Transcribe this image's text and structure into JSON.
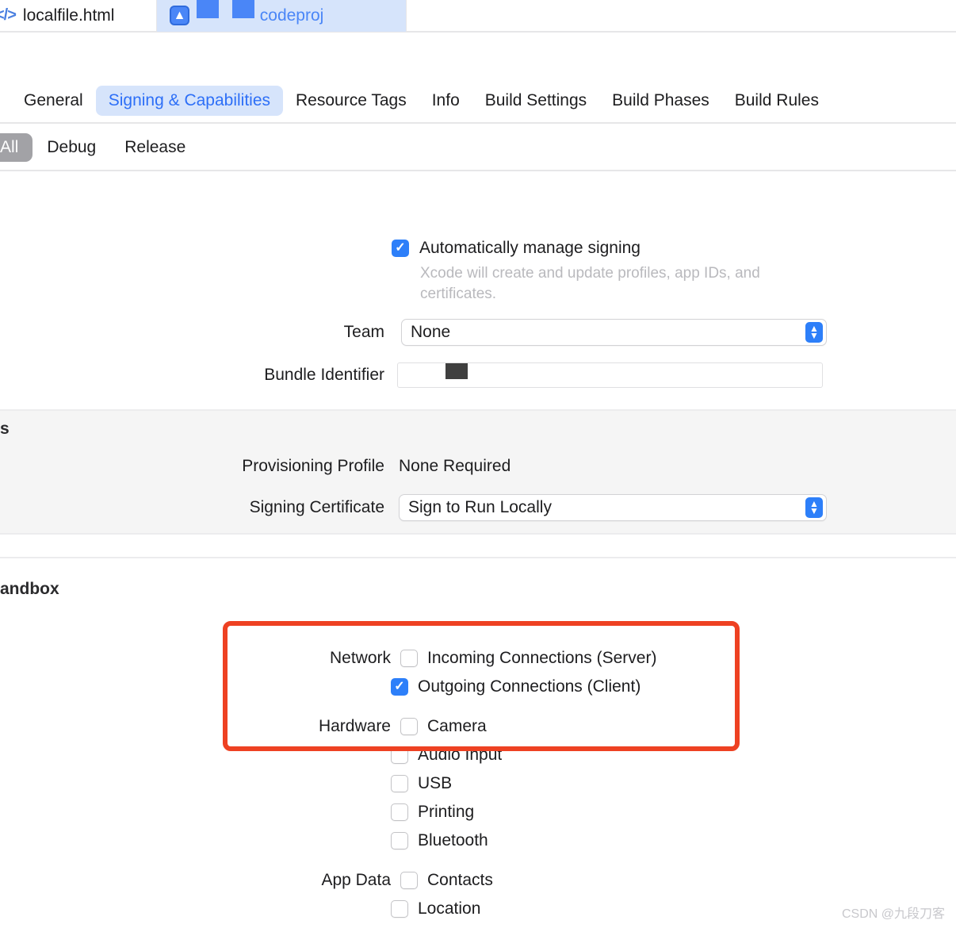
{
  "file_tabs": [
    {
      "name": "localfile.html",
      "icon": "code-file-icon",
      "active": false
    },
    {
      "name": "codeproj",
      "icon": "xcode-project-icon",
      "active": true,
      "redacted": true
    }
  ],
  "project_tabs": [
    {
      "label": "General",
      "selected": false
    },
    {
      "label": "Signing & Capabilities",
      "selected": true
    },
    {
      "label": "Resource Tags",
      "selected": false
    },
    {
      "label": "Info",
      "selected": false
    },
    {
      "label": "Build Settings",
      "selected": false
    },
    {
      "label": "Build Phases",
      "selected": false
    },
    {
      "label": "Build Rules",
      "selected": false
    }
  ],
  "configurations": [
    {
      "label": "All",
      "selected": true
    },
    {
      "label": "Debug",
      "selected": false
    },
    {
      "label": "Release",
      "selected": false
    }
  ],
  "signing": {
    "auto_manage": {
      "label": "Automatically manage signing",
      "checked": true,
      "hint": "Xcode will create and update profiles, app IDs, and certificates."
    },
    "team": {
      "label": "Team",
      "value": "None"
    },
    "bundle_identifier": {
      "label": "Bundle Identifier",
      "value": ""
    }
  },
  "macos_section": {
    "title": "s",
    "provisioning_profile": {
      "label": "Provisioning Profile",
      "value": "None Required"
    },
    "signing_certificate": {
      "label": "Signing Certificate",
      "value": "Sign to Run Locally"
    }
  },
  "app_sandbox": {
    "title": "andbox",
    "groups": [
      {
        "label": "Network",
        "items": [
          {
            "label": "Incoming Connections (Server)",
            "checked": false
          },
          {
            "label": "Outgoing Connections (Client)",
            "checked": true
          }
        ]
      },
      {
        "label": "Hardware",
        "items": [
          {
            "label": "Camera",
            "checked": false
          },
          {
            "label": "Audio Input",
            "checked": false
          },
          {
            "label": "USB",
            "checked": false
          },
          {
            "label": "Printing",
            "checked": false
          },
          {
            "label": "Bluetooth",
            "checked": false
          }
        ]
      },
      {
        "label": "App Data",
        "items": [
          {
            "label": "Contacts",
            "checked": false
          },
          {
            "label": "Location",
            "checked": false
          }
        ]
      }
    ]
  },
  "annotation": {
    "color": "#ee4122"
  },
  "watermark": "CSDN @九段刀客",
  "colors": {
    "accent_blue": "#2d7ff9",
    "tab_selected_bg": "#d6e4fb",
    "tab_selected_text": "#2d6ff7",
    "config_selected_bg": "#a2a2a6",
    "section_gray": "#f5f5f5",
    "annotation_red": "#ee4122"
  },
  "checkmark_glyph": "✓"
}
